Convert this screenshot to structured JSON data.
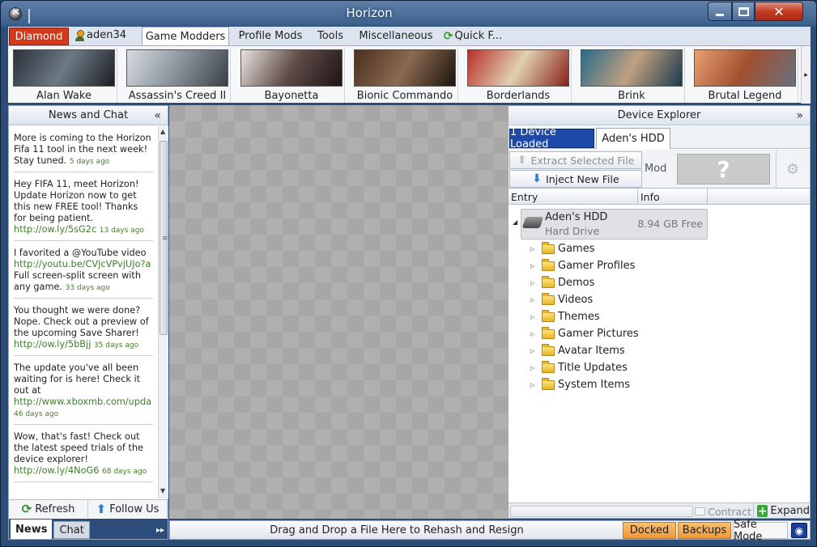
{
  "window": {
    "title": "Horizon"
  },
  "account": {
    "tier": "Diamond",
    "username": "aden34"
  },
  "menu": {
    "tabs": [
      "Game Modders",
      "Profile Mods",
      "Tools",
      "Miscellaneous",
      "Quick F..."
    ]
  },
  "games": [
    "Alan Wake",
    "Assassin's Creed II",
    "Bayonetta",
    "Bionic Commando",
    "Borderlands",
    "Brink",
    "Brutal Legend"
  ],
  "news": {
    "title": "News and Chat",
    "items": [
      {
        "text": "More is coming to the Horizon Fifa 11 tool in the next week! Stay tuned.",
        "link": "",
        "after": "",
        "ago": "5 days ago"
      },
      {
        "text": "Hey FIFA 11, meet Horizon! Update Horizon now to get this new FREE tool! Thanks for being patient.",
        "link": "http://ow.ly/5sG2c",
        "after": "",
        "ago": "13 days ago"
      },
      {
        "text": "I favorited a @YouTube video",
        "link": "http://youtu.be/CVJcVPvjUJo?a",
        "after": "Full screen-split screen with any game.",
        "ago": "33 days ago"
      },
      {
        "text": "You thought we were done? Nope. Check out a preview of the upcoming Save Sharer!",
        "link": "http://ow.ly/5bBjj",
        "after": "",
        "ago": "35 days ago"
      },
      {
        "text": "The update you've all been waiting for is here! Check it out at",
        "link": "http://www.xboxmb.com/upda",
        "after": "",
        "ago": "46 days ago"
      },
      {
        "text": "Wow, that's fast! Check out the latest speed trials of the device explorer!",
        "link": "http://ow.ly/4NoG6",
        "after": "",
        "ago": "68 days ago"
      }
    ],
    "refresh_label": "Refresh",
    "follow_label": "Follow Us",
    "tabs": [
      "News",
      "Chat"
    ]
  },
  "device": {
    "title": "Device Explorer",
    "loaded_label": "1 Device Loaded",
    "tab_label": "Aden's HDD",
    "extract_label": "Extract Selected File",
    "inject_label": "Inject New File",
    "mod_label": "Mod",
    "mod_placeholder": "?",
    "columns": [
      "Entry",
      "Info"
    ],
    "root": {
      "name": "Aden's HDD",
      "type": "Hard Drive",
      "free": "8.94 GB Free"
    },
    "folders": [
      "Games",
      "Gamer Profiles",
      "Demos",
      "Videos",
      "Themes",
      "Gamer Pictures",
      "Avatar Items",
      "Title Updates",
      "System Items"
    ],
    "contract_label": "Contract",
    "expand_label": "Expand"
  },
  "status": {
    "drop_hint": "Drag and Drop a File Here to Rehash and Resign",
    "docked_label": "Docked",
    "backups_label": "Backups",
    "safe_mode_label": "Safe Mode"
  },
  "colors": {
    "accent_orange": "#f09838",
    "diamond_red": "#d23a1a",
    "device_blue": "#1d4aa8",
    "link_green": "#3d7d2a"
  }
}
